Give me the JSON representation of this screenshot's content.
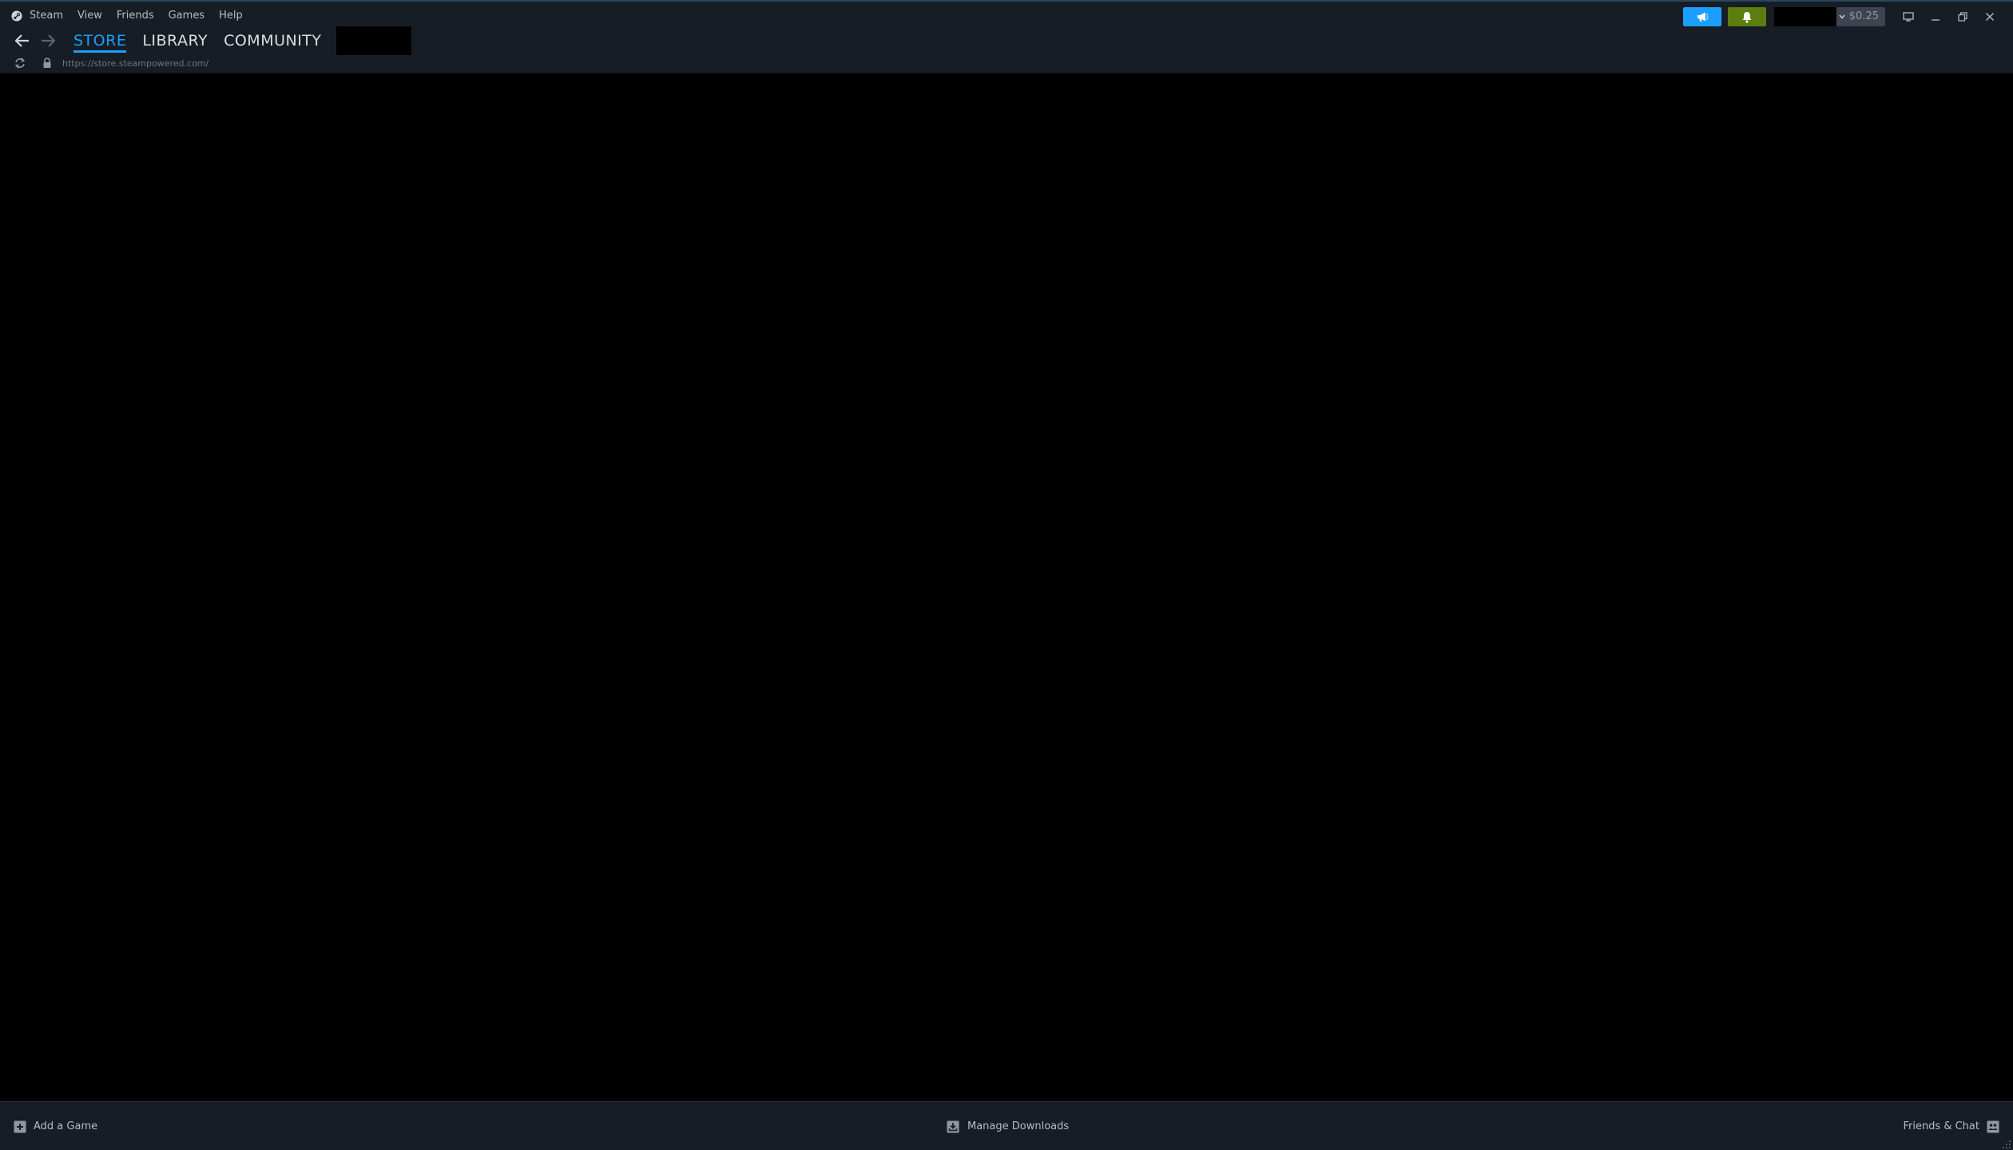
{
  "menubar": {
    "items": [
      "Steam",
      "View",
      "Friends",
      "Games",
      "Help"
    ]
  },
  "nav": {
    "tabs": [
      {
        "label": "STORE",
        "active": true
      },
      {
        "label": "LIBRARY",
        "active": false
      },
      {
        "label": "COMMUNITY",
        "active": false
      }
    ]
  },
  "address": {
    "url": "https://store.steampowered.com/"
  },
  "account": {
    "wallet": "$0.25"
  },
  "footer": {
    "add_game": "Add a Game",
    "manage_downloads": "Manage Downloads",
    "friends_chat": "Friends & Chat"
  },
  "colors": {
    "accent": "#1a9fff",
    "notification": "#5c7e10",
    "chrome_bg": "#171d25",
    "content_bg": "#000000"
  },
  "icons": {
    "logo": "steam-logo-icon",
    "back": "arrow-left-icon",
    "forward": "arrow-right-icon",
    "reload": "reload-icon",
    "lock": "lock-icon",
    "announce": "megaphone-icon",
    "notify": "bell-icon",
    "big_picture": "monitor-icon",
    "minimize": "minimize-icon",
    "restore": "restore-icon",
    "close": "close-icon",
    "add_game": "plus-box-icon",
    "downloads": "download-icon",
    "friends": "friends-icon"
  }
}
